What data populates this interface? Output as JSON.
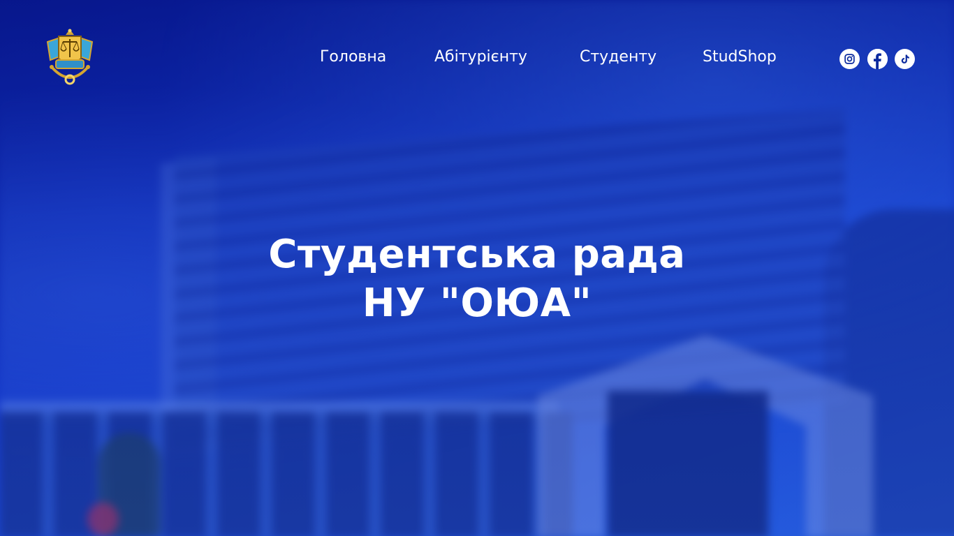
{
  "nav": {
    "items": [
      {
        "label": "Головна"
      },
      {
        "label": "Абітурієнту"
      },
      {
        "label": "Студенту"
      },
      {
        "label": "StudShop"
      }
    ]
  },
  "social": {
    "icons": [
      "instagram-icon",
      "facebook-icon",
      "tiktok-icon"
    ]
  },
  "hero": {
    "title_line1": "Студентська рада",
    "title_line2": "НУ \"ОЮА\""
  },
  "colors": {
    "accent": "#1438c8",
    "text": "#ffffff",
    "logo_gold": "#d4a531",
    "logo_blue": "#3aa6d8"
  }
}
